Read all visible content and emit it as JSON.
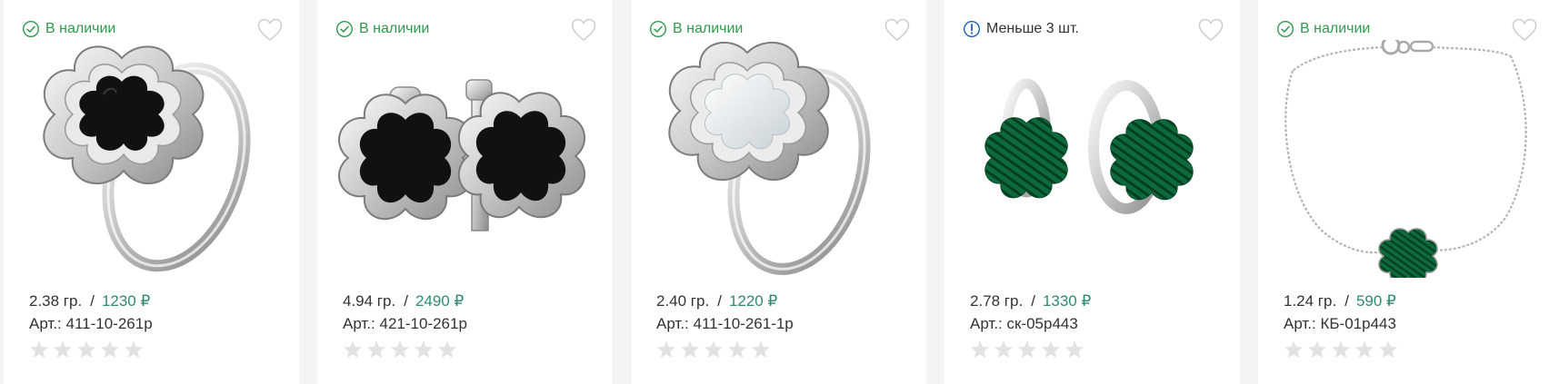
{
  "colors": {
    "instock": "#2e9a4e",
    "price": "#2e8b6e",
    "low_icon": "#1e5fb4",
    "star": "#e2e2e2",
    "heart": "#cfcfcf"
  },
  "products": [
    {
      "availability": "В наличии",
      "availability_type": "instock",
      "availability_icon": "check-circle-icon",
      "weight": "2.38 гр.",
      "price": "1230 ₽",
      "sku": "Арт.: 411-10-261р",
      "rating": 0,
      "image": "ring-black-clover",
      "gem_color": "#111111"
    },
    {
      "availability": "В наличии",
      "availability_type": "instock",
      "availability_icon": "check-circle-icon",
      "weight": "4.94 гр.",
      "price": "2490 ₽",
      "sku": "Арт.: 421-10-261р",
      "rating": 0,
      "image": "earrings-black-clover",
      "gem_color": "#111111"
    },
    {
      "availability": "В наличии",
      "availability_type": "instock",
      "availability_icon": "check-circle-icon",
      "weight": "2.40 гр.",
      "price": "1220 ₽",
      "sku": "Арт.: 411-10-261-1р",
      "rating": 0,
      "image": "ring-pearl-clover",
      "gem_color": "#e6eaec"
    },
    {
      "availability": "Меньше 3 шт.",
      "availability_type": "low",
      "availability_icon": "exclamation-circle-icon",
      "weight": "2.78 гр.",
      "price": "1330 ₽",
      "sku": "Арт.: ск-05р443",
      "rating": 0,
      "image": "hoop-earrings-malachite-clover",
      "gem_color": "#0c6b3c"
    },
    {
      "availability": "В наличии",
      "availability_type": "instock",
      "availability_icon": "check-circle-icon",
      "weight": "1.24 гр.",
      "price": "590 ₽",
      "sku": "Арт.: КБ-01р443",
      "rating": 0,
      "image": "bracelet-malachite-clover",
      "gem_color": "#0c6b3c"
    }
  ]
}
